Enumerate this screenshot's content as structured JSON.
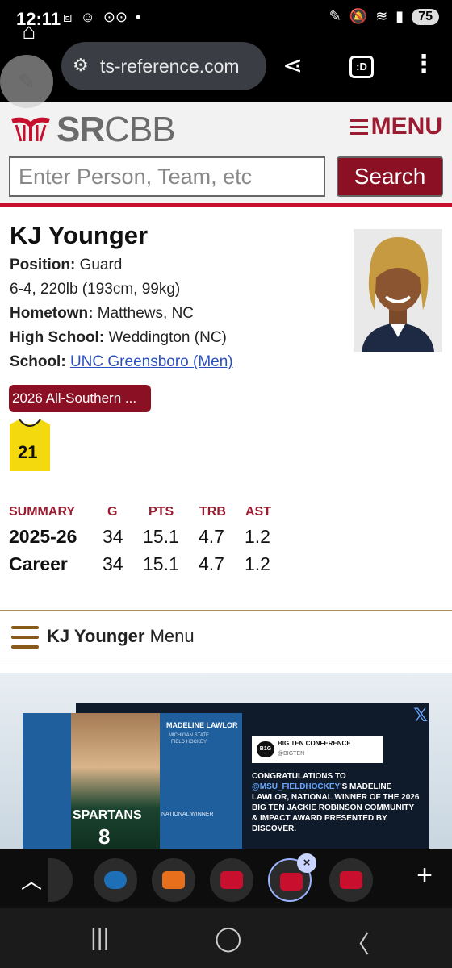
{
  "status_bar": {
    "time": "12:11",
    "battery": "75"
  },
  "browser": {
    "url": "ts-reference.com",
    "tabs_count": ":D"
  },
  "site": {
    "logo_bold": "SR",
    "logo_light": "CBB",
    "menu_label": "MENU",
    "search_placeholder": "Enter Person, Team, etc",
    "search_button": "Search",
    "accent": "#8b1024"
  },
  "player": {
    "name": "KJ Younger",
    "position_label": "Position:",
    "position": "Guard",
    "size": "6-4, 220lb (193cm, 99kg)",
    "hometown_label": "Hometown:",
    "hometown": "Matthews, NC",
    "high_school_label": "High School:",
    "high_school": "Weddington (NC)",
    "school_label": "School:",
    "school": "UNC Greensboro (Men)",
    "award": "2026 All-Southern ...",
    "jersey_number": "21"
  },
  "stats": {
    "headers": [
      "SUMMARY",
      "G",
      "PTS",
      "TRB",
      "AST"
    ],
    "rows": [
      {
        "label": "2025-26",
        "g": "34",
        "pts": "15.1",
        "trb": "4.7",
        "ast": "1.2"
      },
      {
        "label": "Career",
        "g": "34",
        "pts": "15.1",
        "trb": "4.7",
        "ast": "1.2"
      }
    ]
  },
  "player_menu": {
    "name": "KJ Younger",
    "suffix": "Menu"
  },
  "ad": {
    "card_name": "MADELINE LAWLOR",
    "card_sub": "MICHIGAN STATE FIELD HOCKEY",
    "card_winner": "NATIONAL WINNER",
    "jersey_text": "SPARTANS",
    "jersey_number": "8",
    "tweet_account": "BIG TEN CONFERENCE",
    "tweet_handle": "@BIGTEN",
    "tweet_line1": "CONGRATULATIONS TO",
    "tweet_mention": "@MSU_FIELDHOCKEY",
    "tweet_line2": "'S MADELINE LAWLOR, NATIONAL WINNER OF THE 2026 BIG TEN JACKIE ROBINSON COMMUNITY & IMPACT AWARD PRESENTED BY DISCOVER."
  }
}
